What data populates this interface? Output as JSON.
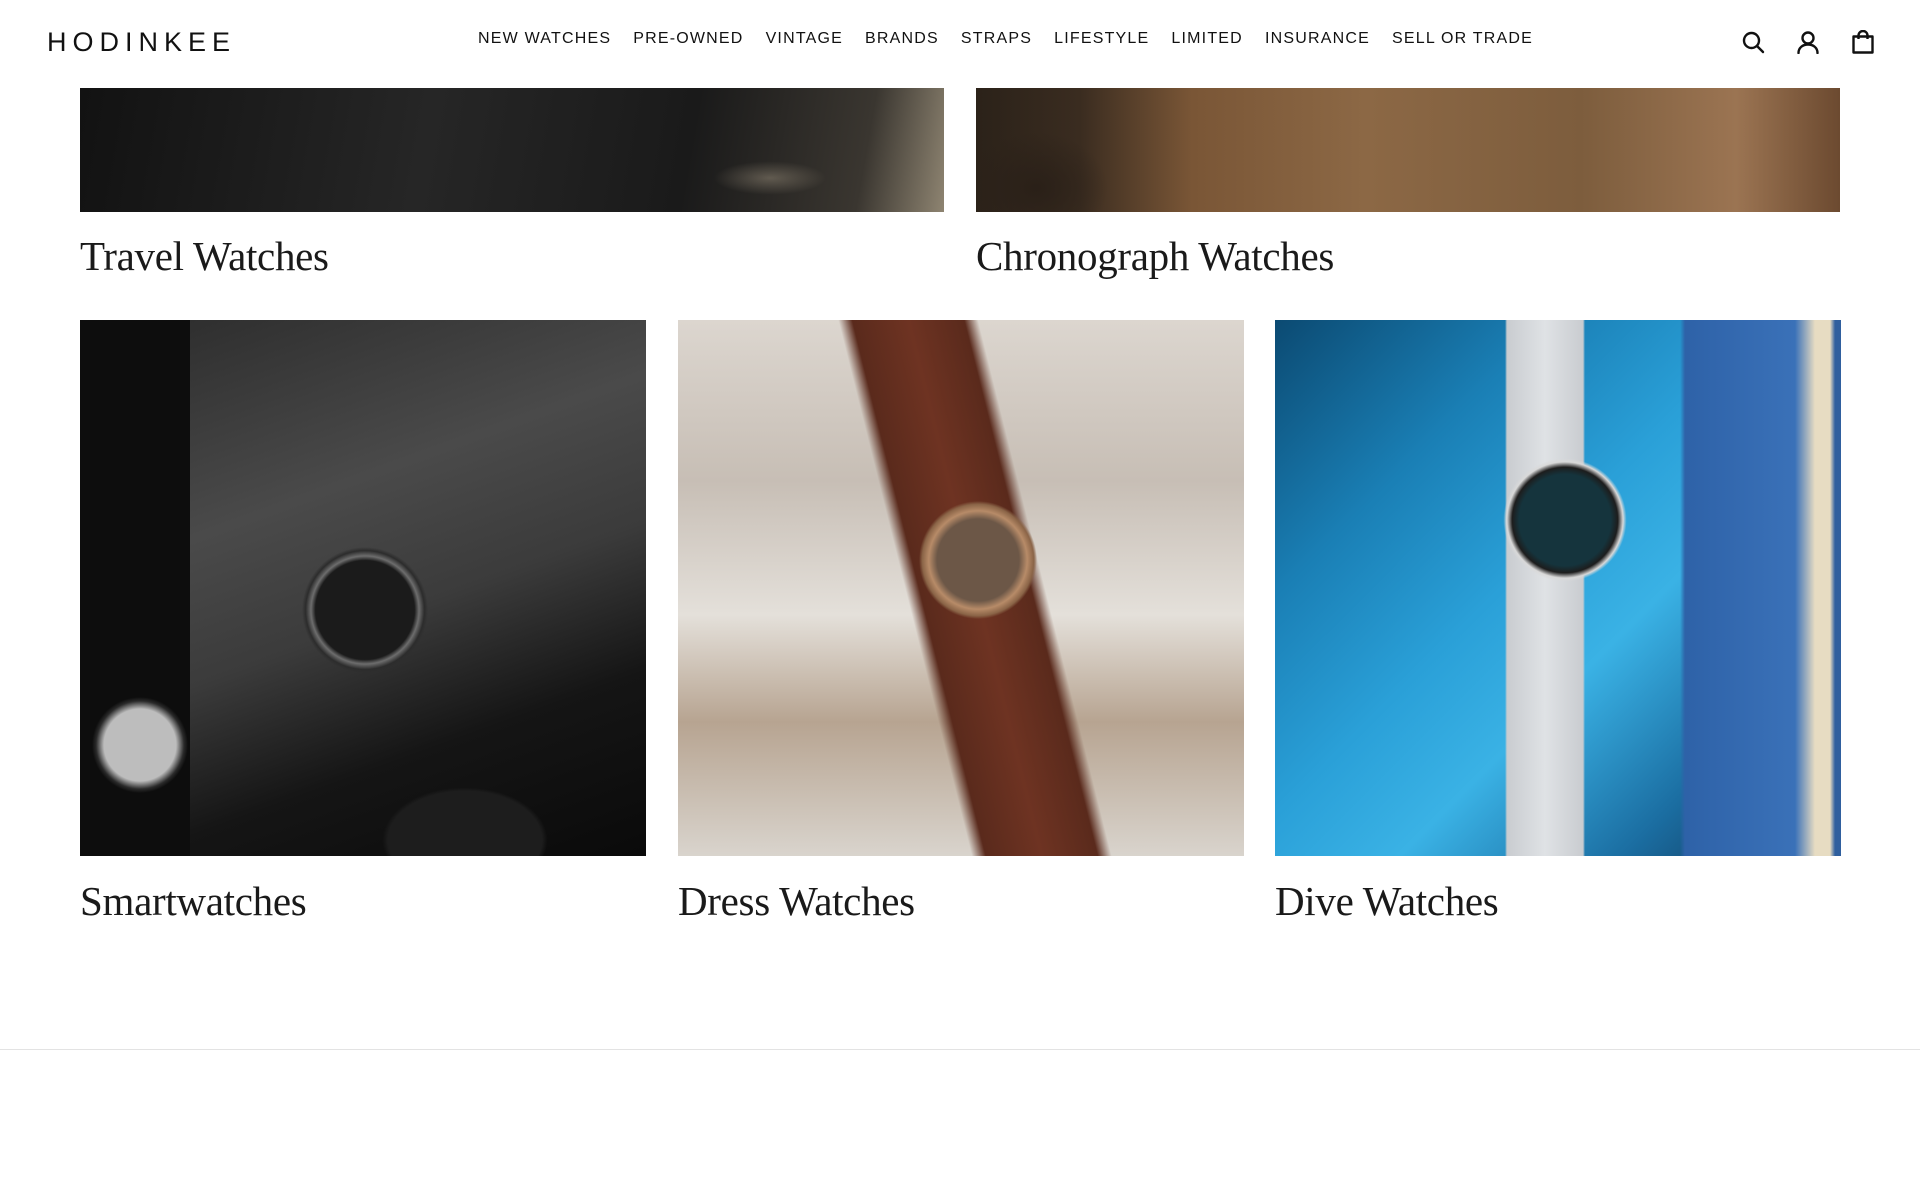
{
  "header": {
    "logo": "HODINKEE",
    "nav": [
      "NEW WATCHES",
      "PRE-OWNED",
      "VINTAGE",
      "BRANDS",
      "STRAPS",
      "LIFESTYLE",
      "LIMITED",
      "INSURANCE",
      "SELL OR TRADE"
    ],
    "icons": [
      "search-icon",
      "account-icon",
      "shopping-bag-icon"
    ]
  },
  "categories": {
    "top_row": [
      {
        "label": "Travel Watches"
      },
      {
        "label": "Chronograph Watches"
      }
    ],
    "bottom_row": [
      {
        "label": "Smartwatches"
      },
      {
        "label": "Dress Watches"
      },
      {
        "label": "Dive Watches"
      }
    ]
  },
  "colors": {
    "background": "#ffffff",
    "text": "#111111",
    "divider": "#e3e3e3"
  }
}
